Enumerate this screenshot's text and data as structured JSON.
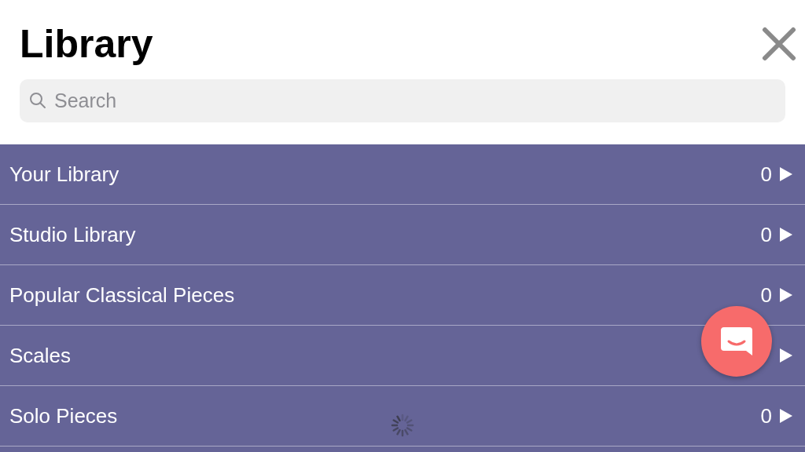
{
  "header": {
    "title": "Library"
  },
  "search": {
    "placeholder": "Search"
  },
  "categories": [
    {
      "label": "Your Library",
      "count": "0"
    },
    {
      "label": "Studio Library",
      "count": "0"
    },
    {
      "label": "Popular Classical Pieces",
      "count": "0"
    },
    {
      "label": "Scales"
    },
    {
      "label": "Solo Pieces",
      "count": "0"
    }
  ]
}
